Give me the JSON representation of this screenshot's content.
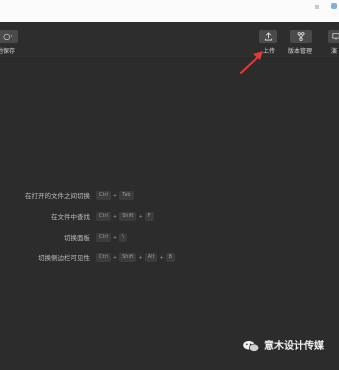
{
  "toolbar": {
    "left_button_label": "○·",
    "left_label": "地保存",
    "buttons": [
      {
        "label": "上传",
        "icon": "upload-icon"
      },
      {
        "label": "版本管理",
        "icon": "branch-icon"
      },
      {
        "label": "演",
        "icon": "present-icon"
      }
    ]
  },
  "shortcuts": [
    {
      "desc": "在打开的文件之间切换",
      "keys": [
        "Ctrl",
        "+",
        "Tab"
      ]
    },
    {
      "desc": "在文件中查找",
      "keys": [
        "Ctrl",
        "+",
        "Shift",
        "+",
        "F"
      ]
    },
    {
      "desc": "切换面板",
      "keys": [
        "Ctrl",
        "+",
        "\\"
      ]
    },
    {
      "desc": "切换侧边栏可见性",
      "keys": [
        "Ctrl",
        "+",
        "Shift",
        "+",
        "Alt",
        "+",
        "B"
      ]
    }
  ],
  "watermark": {
    "text": "意木设计传媒"
  },
  "colors": {
    "background": "#2c2c2c",
    "arrow": "#e53935",
    "topbar": "#fbfbfb"
  }
}
